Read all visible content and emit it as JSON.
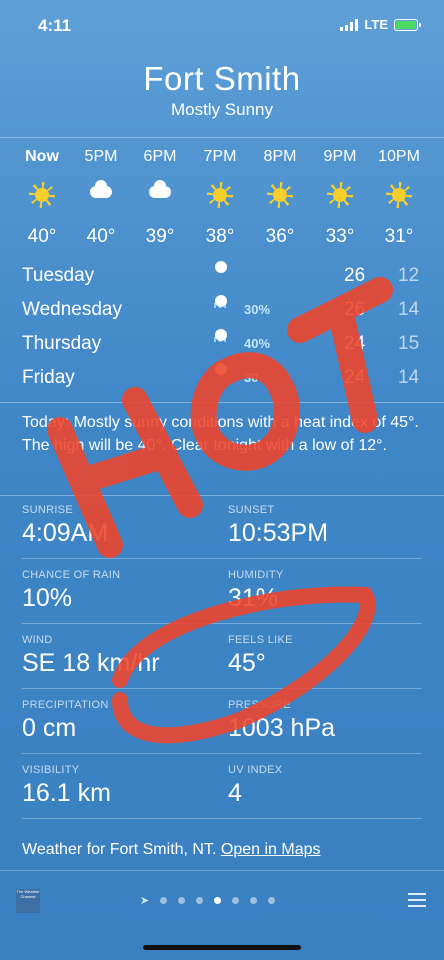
{
  "status": {
    "time": "4:11",
    "network": "LTE"
  },
  "location": {
    "city": "Fort Smith",
    "condition": "Mostly Sunny"
  },
  "hourly": [
    {
      "label": "Now",
      "icon": "sun-icon",
      "temp": "40°"
    },
    {
      "label": "5PM",
      "icon": "partly-cloudy-icon",
      "temp": "40°"
    },
    {
      "label": "6PM",
      "icon": "partly-cloudy-icon",
      "temp": "39°"
    },
    {
      "label": "7PM",
      "icon": "sun-icon",
      "temp": "38°"
    },
    {
      "label": "8PM",
      "icon": "sun-icon",
      "temp": "36°"
    },
    {
      "label": "9PM",
      "icon": "sun-icon",
      "temp": "33°"
    },
    {
      "label": "10PM",
      "icon": "sun-icon",
      "temp": "31°"
    }
  ],
  "daily": [
    {
      "day": "Tuesday",
      "icon": "partly-sunny-icon",
      "precip": "",
      "high": "26",
      "low": "12"
    },
    {
      "day": "Wednesday",
      "icon": "rain-icon",
      "precip": "30%",
      "high": "26",
      "low": "14"
    },
    {
      "day": "Thursday",
      "icon": "rain-icon",
      "precip": "40%",
      "high": "24",
      "low": "15"
    },
    {
      "day": "Friday",
      "icon": "rain-icon",
      "precip": "30",
      "high": "24",
      "low": "14"
    }
  ],
  "summary": "Today: Mostly sunny conditions with a heat index of 45°. The high will be 40°. Clear tonight with a low of 12°.",
  "details": [
    {
      "left": {
        "key": "SUNRISE",
        "value": "4:09AM"
      },
      "right": {
        "key": "SUNSET",
        "value": "10:53PM"
      }
    },
    {
      "left": {
        "key": "CHANCE OF RAIN",
        "value": "10%"
      },
      "right": {
        "key": "HUMIDITY",
        "value": "31%"
      }
    },
    {
      "left": {
        "key": "WIND",
        "value": "SE 18 km/hr"
      },
      "right": {
        "key": "FEELS LIKE",
        "value": "45°"
      }
    },
    {
      "left": {
        "key": "PRECIPITATION",
        "value": "0 cm"
      },
      "right": {
        "key": "PRESSURE",
        "value": "1003 hPa"
      }
    },
    {
      "left": {
        "key": "VISIBILITY",
        "value": "16.1 km"
      },
      "right": {
        "key": "UV INDEX",
        "value": "4"
      }
    }
  ],
  "footer": {
    "text": "Weather for Fort Smith, NT.",
    "link": "Open in Maps",
    "logo": "The Weather Channel"
  },
  "annotation": {
    "text": "HOT",
    "color": "#f0442a"
  }
}
